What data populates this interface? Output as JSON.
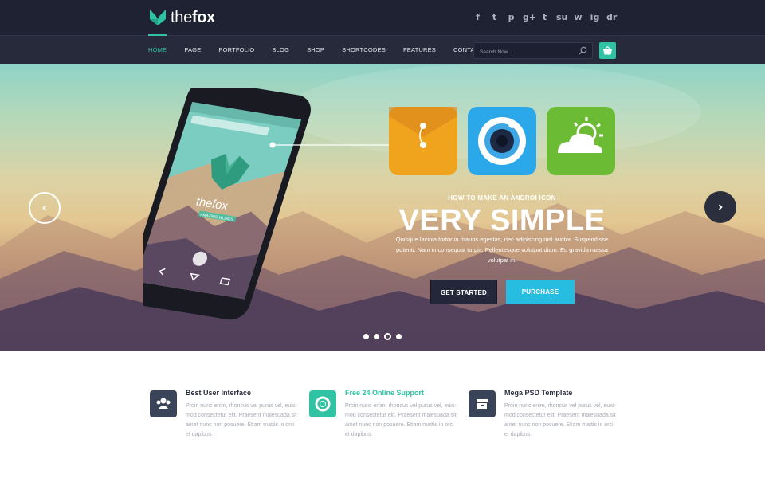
{
  "brand": {
    "prefix": "the",
    "name": "fox"
  },
  "social": [
    "f",
    "t",
    "p",
    "g+",
    "t",
    "su",
    "ig",
    "w",
    "dr"
  ],
  "nav": [
    "HOME",
    "PAGE",
    "PORTFOLIO",
    "BLOG",
    "SHOP",
    "SHORTCODES",
    "FEATURES",
    "CONTACT"
  ],
  "search": {
    "placeholder": "Search Now..."
  },
  "hero": {
    "subtitle": "HOW TO MAKE AN ANDROI ICON",
    "title": "VERY SIMPLE",
    "text": "Quisque lacinia tortor in mauris egestas, nec adipiscing nisl auctor. Suspendisse potenti. Nam in consequat turpis. Pellentesque volutpat diam. Eu gravida massa volutpat in.",
    "btn_primary": "GET STARTED",
    "btn_secondary": "PURCHASE",
    "phone_brand": "thefox",
    "phone_tagline": "AMAZING WORKS"
  },
  "slider": {
    "count": 4,
    "active": 2
  },
  "features": [
    {
      "title": "Best User Interface",
      "text": "Proin nunc enim, rhoncus vel purus vel, euis-mod consectetur elit. Praesent malesuada sit amet nunc non posuere. Etiam mattis in orci et dapibus."
    },
    {
      "title": "Free 24 Online Support",
      "text": "Proin nunc enim, rhoncus vel purus vel, euis-mod consectetur elit. Praesent malesuada sit amet nunc non posuere. Etiam mattis in orci et dapibus."
    },
    {
      "title": "Mega PSD Template",
      "text": "Proin nunc enim, rhoncus vel purus vel, euis-mod consectetur elit. Praesent malesuada sit amet nunc non posuere. Etiam mattis in orci et dapibus."
    }
  ],
  "colors": {
    "accent": "#2fc3a4",
    "dark": "#1f2232",
    "cyan": "#27bde0"
  }
}
